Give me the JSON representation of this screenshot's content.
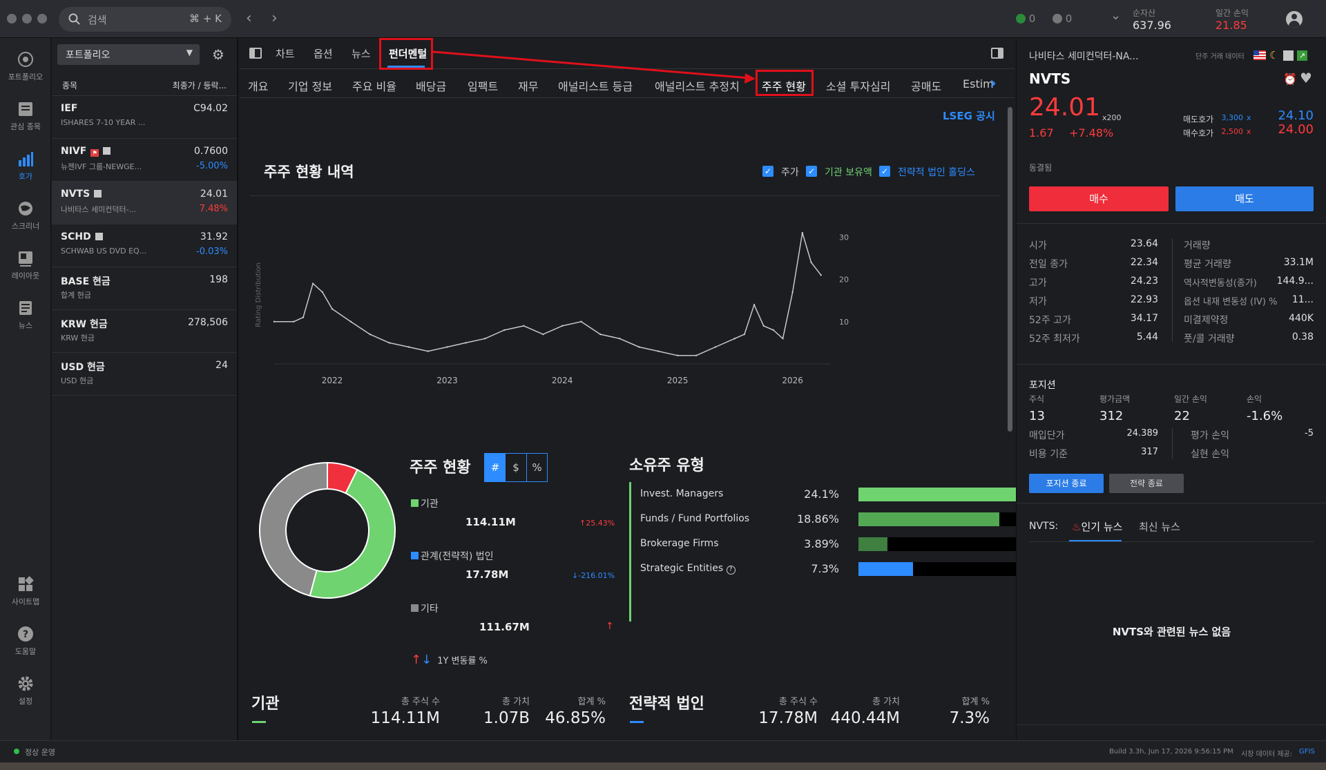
{
  "topbar": {
    "search_placeholder": "검색",
    "search_shortcut": "⌘ + K",
    "status_green_count": "0",
    "status_gray_count": "0",
    "net_assets_label": "순자산",
    "net_assets_value": "637.96",
    "daily_pnl_label": "일간 손익",
    "daily_pnl_value": "21.85"
  },
  "leftnav": [
    {
      "label": "포트폴리오",
      "icon": "portfolio-icon"
    },
    {
      "label": "관심 종목",
      "icon": "watchlist-icon"
    },
    {
      "label": "호가",
      "icon": "quote-icon"
    },
    {
      "label": "스크리너",
      "icon": "screener-icon"
    },
    {
      "label": "레이아웃",
      "icon": "layout-icon"
    },
    {
      "label": "뉴스",
      "icon": "news-icon"
    },
    {
      "label": "사이트맵",
      "icon": "sitemap-icon"
    },
    {
      "label": "도움말",
      "icon": "help-icon"
    },
    {
      "label": "설정",
      "icon": "settings-icon"
    }
  ],
  "portfolio": {
    "selector": "포트폴리오",
    "col_symbol": "종목",
    "col_price": "최종가 / 등락...",
    "rows": [
      {
        "symbol": "IEF",
        "name": "ISHARES 7-10 YEAR ...",
        "price": "C94.02",
        "change": ""
      },
      {
        "symbol": "NIVF",
        "name": "뉴젠IVF 그룹-NEWGE...",
        "price": "0.7600",
        "change": "-5.00%"
      },
      {
        "symbol": "NVTS",
        "name": "나비타스 세미컨덕터-...",
        "price": "24.01",
        "change": "7.48%"
      },
      {
        "symbol": "SCHD",
        "name": "SCHWAB US DVD EQ...",
        "price": "31.92",
        "change": "-0.03%"
      },
      {
        "symbol": "BASE 현금",
        "name": "합계 현금",
        "price": "198",
        "change": ""
      },
      {
        "symbol": "KRW 현금",
        "name": "KRW 현금",
        "price": "278,506",
        "change": ""
      },
      {
        "symbol": "USD 현금",
        "name": "USD 현금",
        "price": "24",
        "change": ""
      }
    ]
  },
  "main_tabs": [
    "차트",
    "옵션",
    "뉴스",
    "펀더멘털"
  ],
  "sub_tabs": [
    "개요",
    "기업 정보",
    "주요 비율",
    "배당금",
    "임팩트",
    "재무",
    "애널리스트 등급",
    "애널리스트 추정치",
    "주주 현황",
    "소셜 투자심리",
    "공매도",
    "Estim"
  ],
  "lseg": "LSEG 공시",
  "holders_history": {
    "title": "주주 현황 내역",
    "toggles": [
      "주가",
      "기관 보유액",
      "전략적 법인 홀딩스"
    ]
  },
  "chart_data": {
    "type": "line",
    "ylabel": "Rating Distribution",
    "x_ticks": [
      "2022",
      "2023",
      "2024",
      "2025",
      "2026"
    ],
    "y_ticks": [
      "10",
      "20",
      "30"
    ],
    "ylim": [
      0,
      32
    ],
    "series": [
      {
        "name": "주가",
        "x": [
          "2021-07",
          "2021-09",
          "2021-10",
          "2021-11",
          "2021-12",
          "2022-01",
          "2022-03",
          "2022-05",
          "2022-07",
          "2022-09",
          "2022-11",
          "2023-01",
          "2023-03",
          "2023-05",
          "2023-07",
          "2023-09",
          "2023-11",
          "2024-01",
          "2024-03",
          "2024-05",
          "2024-07",
          "2024-09",
          "2024-11",
          "2025-01",
          "2025-03",
          "2025-05",
          "2025-07",
          "2025-08",
          "2025-09",
          "2025-10",
          "2025-11",
          "2025-12",
          "2026-01",
          "2026-02",
          "2026-03",
          "2026-04"
        ],
        "values": [
          10,
          10,
          11,
          19,
          17,
          13,
          10,
          7,
          5,
          4,
          3,
          4,
          5,
          6,
          8,
          9,
          7,
          9,
          10,
          7,
          6,
          4,
          3,
          2,
          2,
          4,
          6,
          7,
          14,
          9,
          8,
          6,
          17,
          31,
          24,
          21
        ]
      }
    ]
  },
  "holders": {
    "title": "주주 현황",
    "modes": [
      "#",
      "$",
      "%"
    ],
    "items": [
      {
        "label": "기관",
        "value": "114.11M",
        "change": "25.43%",
        "color": "#6fd36f"
      },
      {
        "label": "관계(전략적) 법인",
        "value": "17.78M",
        "change": "-216.01%",
        "color": "#2d8cff"
      },
      {
        "label": "기타",
        "value": "111.67M",
        "change": "",
        "color": "#8a8a8a"
      }
    ],
    "footer": "1Y 변동률 %"
  },
  "ownership_types": {
    "title": "소유주 유형",
    "rows": [
      {
        "name": "Invest. Managers",
        "pct": "24.1%",
        "fill": 1.0,
        "color": "#6fd36f"
      },
      {
        "name": "Funds / Fund Portfolios",
        "pct": "18.86%",
        "fill": 0.78,
        "color": "#53a853"
      },
      {
        "name": "Brokerage Firms",
        "pct": "3.89%",
        "fill": 0.16,
        "color": "#3f7f3f"
      },
      {
        "name": "Strategic Entities",
        "pct": "7.3%",
        "fill": 0.3,
        "color": "#2d8cff"
      }
    ]
  },
  "institutions": {
    "title": "기관",
    "shares_label": "총 주식 수",
    "shares": "114.11M",
    "value_label": "총 가치",
    "value": "1.07B",
    "pct_label": "합계 %",
    "pct": "46.85%"
  },
  "strategic": {
    "title": "전략적 법인",
    "shares_label": "총 주식 수",
    "shares": "17.78M",
    "value_label": "총 가치",
    "value": "440.44M",
    "pct_label": "합계 %",
    "pct": "7.3%"
  },
  "quote": {
    "name": "나비타스 세미컨덕터-NA...",
    "data_label": "단주 거래 데이터",
    "symbol": "NVTS",
    "price": "24.01",
    "size": "x200",
    "change": "1.67",
    "change_pct": "+7.48%",
    "ask_label": "매도호가",
    "ask_size": "3,300",
    "ask_price": "24.10",
    "bid_label": "매수호가",
    "bid_size": "2,500",
    "bid_price": "24.00",
    "x_sep": "x",
    "sync_label": "동결됨",
    "buy": "매수",
    "sell": "매도",
    "stats_left": [
      {
        "label": "시가",
        "value": "23.64"
      },
      {
        "label": "전일 종가",
        "value": "22.34"
      },
      {
        "label": "고가",
        "value": "24.23"
      },
      {
        "label": "저가",
        "value": "22.93"
      },
      {
        "label": "52주 고가",
        "value": "34.17"
      },
      {
        "label": "52주 최저가",
        "value": "5.44"
      }
    ],
    "stats_right": [
      {
        "label": "거래량",
        "value": ""
      },
      {
        "label": "평균 거래량",
        "value": "33.1M"
      },
      {
        "label": "역사적변동성(종가)",
        "value": "144.9..."
      },
      {
        "label": "옵션 내재 변동성 (IV) %",
        "value": "11..."
      },
      {
        "label": "미결제약정",
        "value": "440K"
      },
      {
        "label": "풋/콜 거래량",
        "value": "0.38"
      }
    ]
  },
  "position": {
    "title": "포지션",
    "cols": [
      {
        "label": "주식",
        "value": "13"
      },
      {
        "label": "평가금액",
        "value": "312"
      },
      {
        "label": "일간 손익",
        "value": "22"
      },
      {
        "label": "손익",
        "value": "-1.6%"
      }
    ],
    "avg_cost_label": "매입단가",
    "avg_cost": "24.389",
    "cost_basis_label": "비용 기준",
    "cost_basis": "317",
    "unrealized_label": "평가 손익",
    "unrealized": "-5",
    "realized_label": "실현 손익",
    "realized": "",
    "close_btn": "포지션 종료",
    "strategy_btn": "전략 종료"
  },
  "news": {
    "prefix": "NVTS:",
    "tabs": [
      "인기 뉴스",
      "최신 뉴스"
    ],
    "empty": "NVTS와 관련된 뉴스 없음"
  },
  "statusbar": {
    "status": "정상 운영",
    "build": "Build 3.3h, Jun 17, 2026 9:56:15 PM",
    "market_data_label": "시장 데이터 제공:",
    "market_data_provider": "GFIS"
  },
  "colors": {
    "accent": "#2d8cff",
    "up": "#ff3b3b",
    "down": "#2d8cff",
    "green": "#6fd36f",
    "highlight": "#e0101a"
  }
}
